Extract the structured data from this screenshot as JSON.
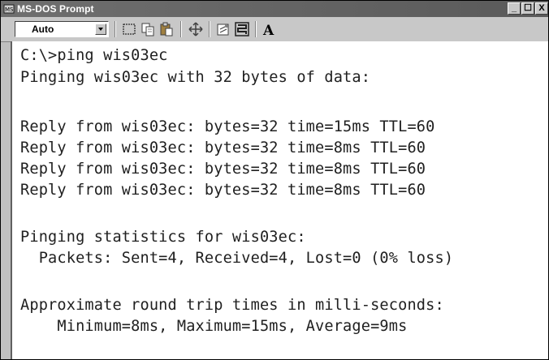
{
  "window": {
    "title": "MS-DOS Prompt"
  },
  "title_buttons": {
    "minimize": "_",
    "maximize": "☐",
    "close": "X"
  },
  "toolbar": {
    "font_select_value": "Auto",
    "tools": [
      {
        "icon": "mark-icon"
      },
      {
        "icon": "copy-icon"
      },
      {
        "icon": "paste-icon"
      },
      {
        "icon": "fullscreen-icon"
      },
      {
        "icon": "properties-icon"
      },
      {
        "icon": "background-icon"
      },
      {
        "icon": "font-icon",
        "label": "A"
      }
    ]
  },
  "console": {
    "lines": [
      "C:\\>ping wis03ec",
      "Pinging wis03ec with 32 bytes of data:",
      "",
      "Reply from wis03ec: bytes=32 time=15ms TTL=60",
      "Reply from wis03ec: bytes=32 time=8ms TTL=60",
      "Reply from wis03ec: bytes=32 time=8ms TTL=60",
      "Reply from wis03ec: bytes=32 time=8ms TTL=60",
      "",
      "Pinging statistics for wis03ec:",
      "  Packets: Sent=4, Received=4, Lost=0 (0% loss)",
      "",
      "Approximate round trip times in milli-seconds:",
      "    Minimum=8ms, Maximum=15ms, Average=9ms"
    ]
  }
}
